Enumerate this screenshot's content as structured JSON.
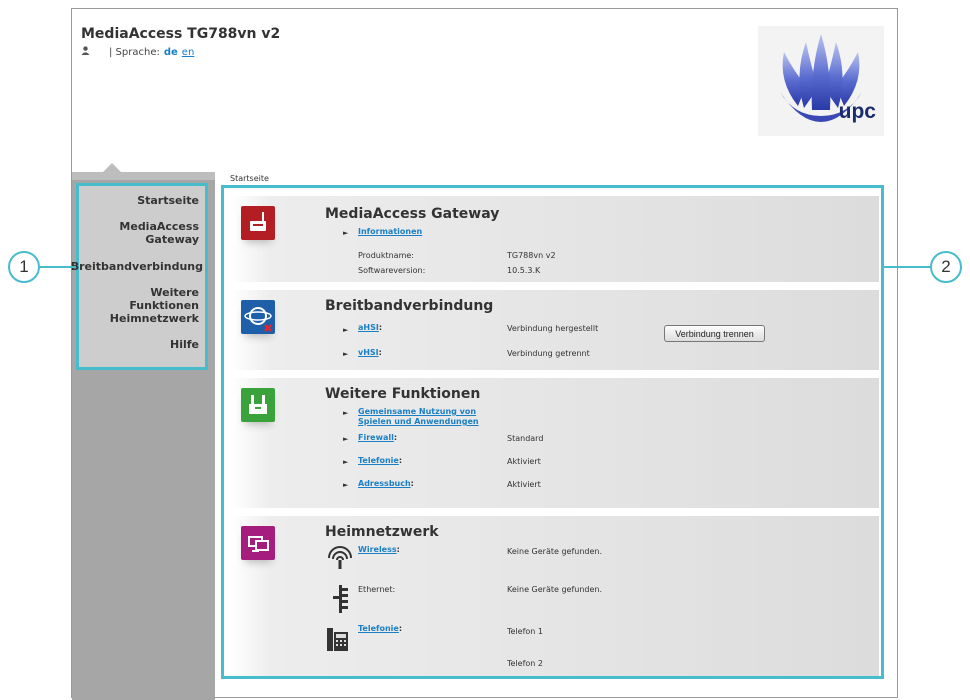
{
  "header": {
    "title": "MediaAccess TG788vn v2",
    "language_label": "| Sprache:",
    "language_current": "de",
    "language_alt": "en",
    "user_icon": "user-icon",
    "brand": "upc"
  },
  "sidebar": {
    "items": [
      {
        "label": "Startseite"
      },
      {
        "label": "MediaAccess Gateway"
      },
      {
        "label": "Breitbandverbindung"
      },
      {
        "label": "Weitere Funktionen"
      },
      {
        "label": "Heimnetzwerk"
      },
      {
        "label": "Hilfe"
      }
    ]
  },
  "breadcrumb": "Startseite",
  "sections": {
    "gateway": {
      "title": "MediaAccess Gateway",
      "icon": "router-icon",
      "link": "Informationen",
      "product_label": "Produktname:",
      "product_value": "TG788vn v2",
      "software_label": "Softwareversion:",
      "software_value": "10.5.3.K"
    },
    "broadband": {
      "title": "Breitbandverbindung",
      "icon": "globe-disconnected-icon",
      "ahsi_link": "aHSI",
      "ahsi_status": "Verbindung hergestellt",
      "button": "Verbindung trennen",
      "vhsi_link": "vHSI",
      "vhsi_status": "Verbindung getrennt"
    },
    "functions": {
      "title": "Weitere Funktionen",
      "icon": "toolbox-icon",
      "sharing_link": "Gemeinsame Nutzung von Spielen und Anwendungen",
      "firewall_link": "Firewall",
      "firewall_value": "Standard",
      "telephony_link": "Telefonie",
      "telephony_value": "Aktiviert",
      "addressbook_link": "Adressbuch",
      "addressbook_value": "Aktiviert"
    },
    "homenet": {
      "title": "Heimnetzwerk",
      "icon": "home-network-icon",
      "wireless_link": "Wireless",
      "wireless_value": "Keine Geräte gefunden.",
      "ethernet_label": "Ethernet:",
      "ethernet_value": "Keine Geräte gefunden.",
      "phone_link": "Telefonie",
      "phone_value_1": "Telefon 1",
      "phone_value_2": "Telefon 2"
    }
  },
  "callouts": [
    "1",
    "2"
  ],
  "colors": {
    "accent": "#47bccb",
    "link": "#1a7fc4",
    "gateway_icon": "#b31d24",
    "broadband_icon": "#1d5fa8",
    "functions_icon": "#3aa23a",
    "homenet_icon": "#a51d7d"
  }
}
